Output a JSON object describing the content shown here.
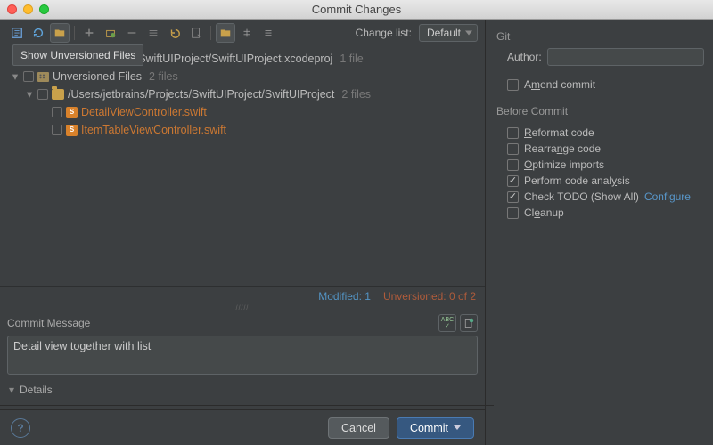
{
  "window": {
    "title": "Commit Changes"
  },
  "toolbar": {
    "tooltip": "Show Unversioned Files",
    "change_list_label": "Change list:",
    "change_list_value": "Default"
  },
  "tree": {
    "root_path": "rains/Projects/SwiftUIProject/SwiftUIProject.xcodeproj",
    "root_count": "1 file",
    "unversioned_label": "Unversioned Files",
    "unversioned_count": "2 files",
    "folder_path": "/Users/jetbrains/Projects/SwiftUIProject/SwiftUIProject",
    "folder_count": "2 files",
    "files": [
      {
        "name": "DetailViewController.swift"
      },
      {
        "name": "ItemTableViewController.swift"
      }
    ]
  },
  "status": {
    "modified": "Modified: 1",
    "unversioned": "Unversioned: 0 of 2"
  },
  "commit_message": {
    "header": "Commit Message",
    "text": "Detail view together with list"
  },
  "details": {
    "label": "Details"
  },
  "git": {
    "section": "Git",
    "author_label": "Author:",
    "amend": "Amend commit",
    "amend_u": "m"
  },
  "before": {
    "section": "Before Commit",
    "reformat": "Reformat code",
    "reformat_u": "R",
    "rearrange": "Rearrange code",
    "rearrange_u": "n",
    "optimize": "Optimize imports",
    "optimize_u": "O",
    "analysis": "Perform code analysis",
    "analysis_u": "y",
    "todo": "Check TODO (Show All)",
    "configure": "Configure",
    "cleanup": "Cleanup",
    "cleanup_u": "e"
  },
  "buttons": {
    "cancel": "Cancel",
    "commit": "Commit"
  },
  "icons": {
    "spell": "ABC"
  }
}
